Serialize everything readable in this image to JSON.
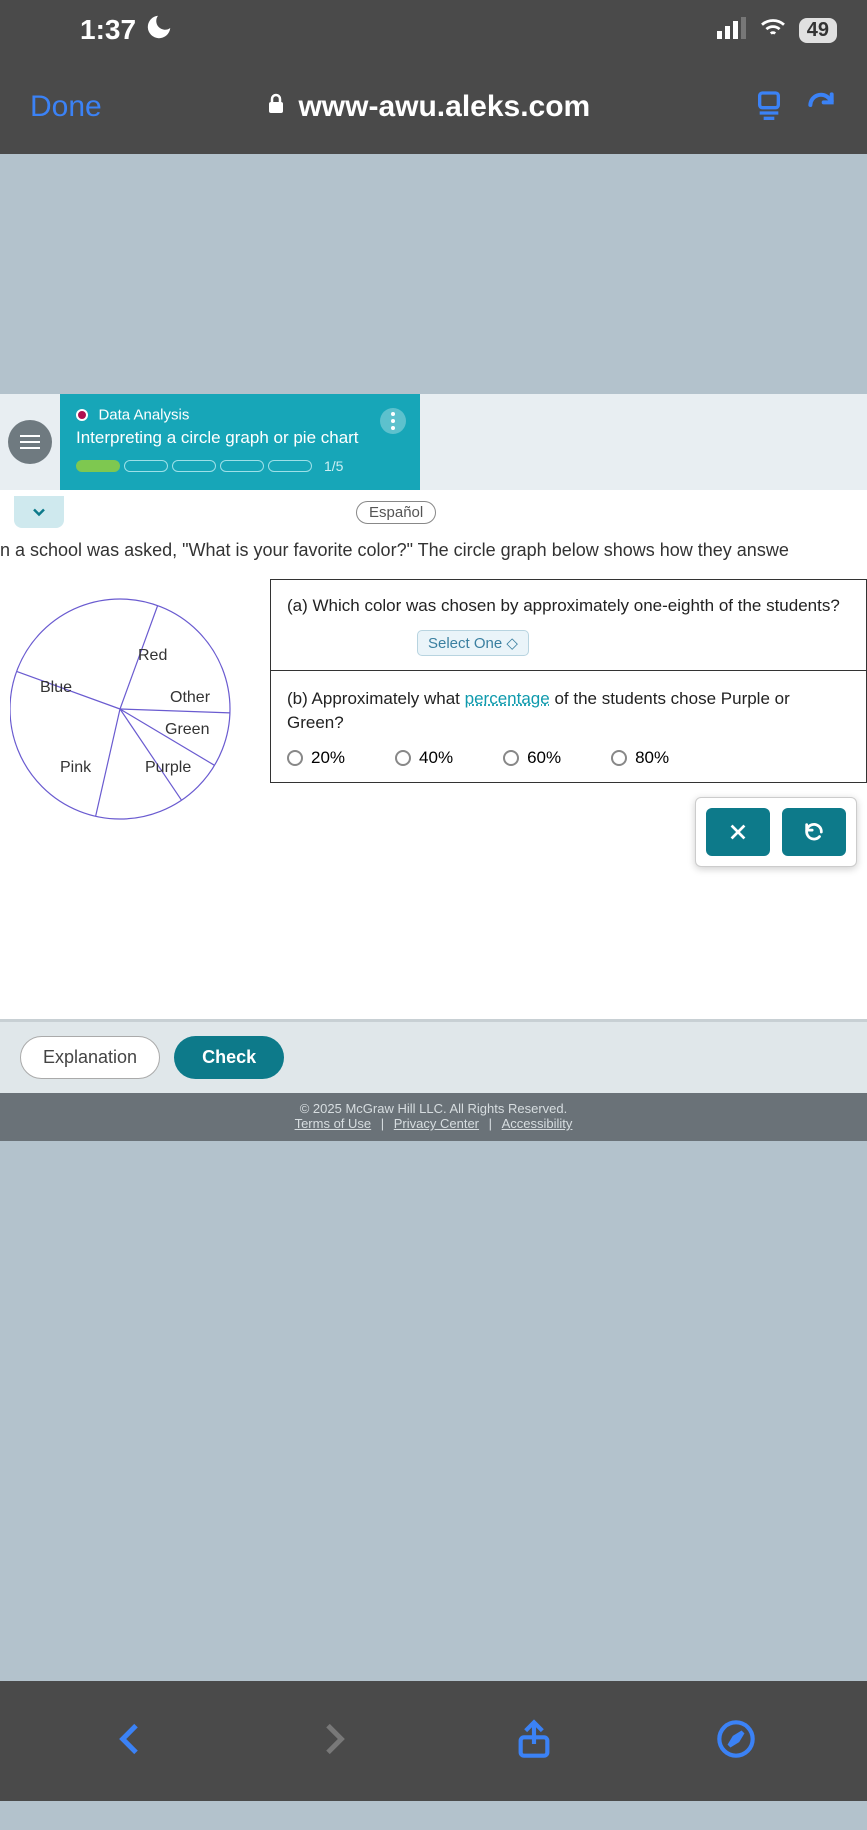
{
  "status": {
    "time": "1:37",
    "battery": "49"
  },
  "browser": {
    "done": "Done",
    "url": "www-awu.aleks.com"
  },
  "aleks": {
    "category": "Data Analysis",
    "title": "Interpreting a circle graph or pie chart",
    "progress_label": "1/5"
  },
  "lang_button": "Español",
  "question_intro": "n a school was asked, \"What is your favorite color?\" The circle graph below shows how they answe",
  "part_a": {
    "prompt": "(a) Which color was chosen by approximately one-eighth of the students?",
    "select_label": "Select One ◇"
  },
  "part_b": {
    "prompt_pre": "(b) Approximately what ",
    "prompt_link": "percentage",
    "prompt_post": " of the students chose Purple or Green?",
    "options": [
      "20%",
      "40%",
      "60%",
      "80%"
    ]
  },
  "pie_labels": {
    "blue": "Blue",
    "red": "Red",
    "other": "Other",
    "green": "Green",
    "purple": "Purple",
    "pink": "Pink"
  },
  "footer": {
    "explanation": "Explanation",
    "check": "Check"
  },
  "copyright": {
    "text": "© 2025 McGraw Hill LLC. All Rights Reserved.",
    "links": [
      "Terms of Use",
      "Privacy Center",
      "Accessibility"
    ]
  },
  "chart_data": {
    "type": "pie",
    "title": "Favorite color",
    "series": [
      {
        "name": "Blue",
        "value": 25
      },
      {
        "name": "Red",
        "value": 20
      },
      {
        "name": "Other",
        "value": 8
      },
      {
        "name": "Green",
        "value": 7
      },
      {
        "name": "Purple",
        "value": 13
      },
      {
        "name": "Pink",
        "value": 27
      }
    ]
  }
}
